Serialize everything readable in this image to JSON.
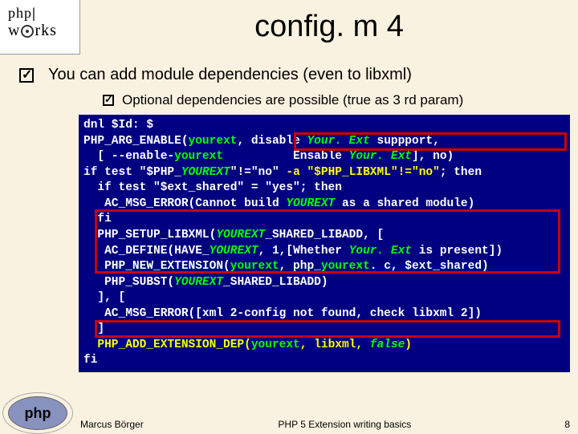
{
  "logo": {
    "top": "php",
    "bottom_pre": "w",
    "bottom_post": "rks"
  },
  "slide": {
    "title": "config. m 4",
    "bullet": "You can add module dependencies (even to libxml)",
    "sub_bullet": "Optional dependencies are possible (true as 3 rd param)"
  },
  "code": {
    "l1a": "dnl $Id: $",
    "l2a": "PHP_ARG_ENABLE(",
    "l2b": "yourext",
    "l2c": ", disable ",
    "l2d": "Your. Ext",
    "l2e": " suppport,",
    "l3a": "  [ --enable-",
    "l3b": "yourext",
    "l3c": "          Ensable ",
    "l3d": "Your. Ext",
    "l3e": "], no)",
    "l4a": "if test \"$PHP_",
    "l4b": "YOUREXT",
    "l4c": "\"!=\"no\" ",
    "l4d": "-a \"$PHP_LIBXML\"!=\"no\"",
    "l4e": "; then",
    "l5a": "  if test \"$ext_shared\" = \"yes\"; then",
    "l6a": "   AC_MSG_ERROR(Cannot build ",
    "l6b": "YOUREXT",
    "l6c": " as a shared module)",
    "l7a": "  fi",
    "l8a": "  PHP_SETUP_LIBXML(",
    "l8b": "YOUREXT",
    "l8c": "_SHARED_LIBADD, [",
    "l9a": "   AC_DEFINE(HAVE_",
    "l9b": "YOUREXT",
    "l9c": ", 1,[Whether ",
    "l9d": "Your. Ext",
    "l9e": " is present])",
    "l10a": "   PHP_NEW_EXTENSION(",
    "l10b": "yourext",
    "l10c": ", php_",
    "l10d": "yourext",
    "l10e": ". c, $ext_shared)",
    "l11a": "   PHP_SUBST(",
    "l11b": "YOUREXT",
    "l11c": "_SHARED_LIBADD)",
    "l12a": "  ], [",
    "l13a": "   AC_MSG_ERROR([xml 2-config not found, check libxml 2])",
    "l14a": "  ]",
    "l15a": "  PHP_ADD_EXTENSION_DEP(",
    "l15b": "yourext",
    "l15c": ", libxml, ",
    "l15d": "false",
    "l15e": ")",
    "l16a": "fi"
  },
  "footer": {
    "author": "Marcus Börger",
    "center": "PHP 5 Extension writing basics",
    "page": "8",
    "logo_text": "php"
  }
}
